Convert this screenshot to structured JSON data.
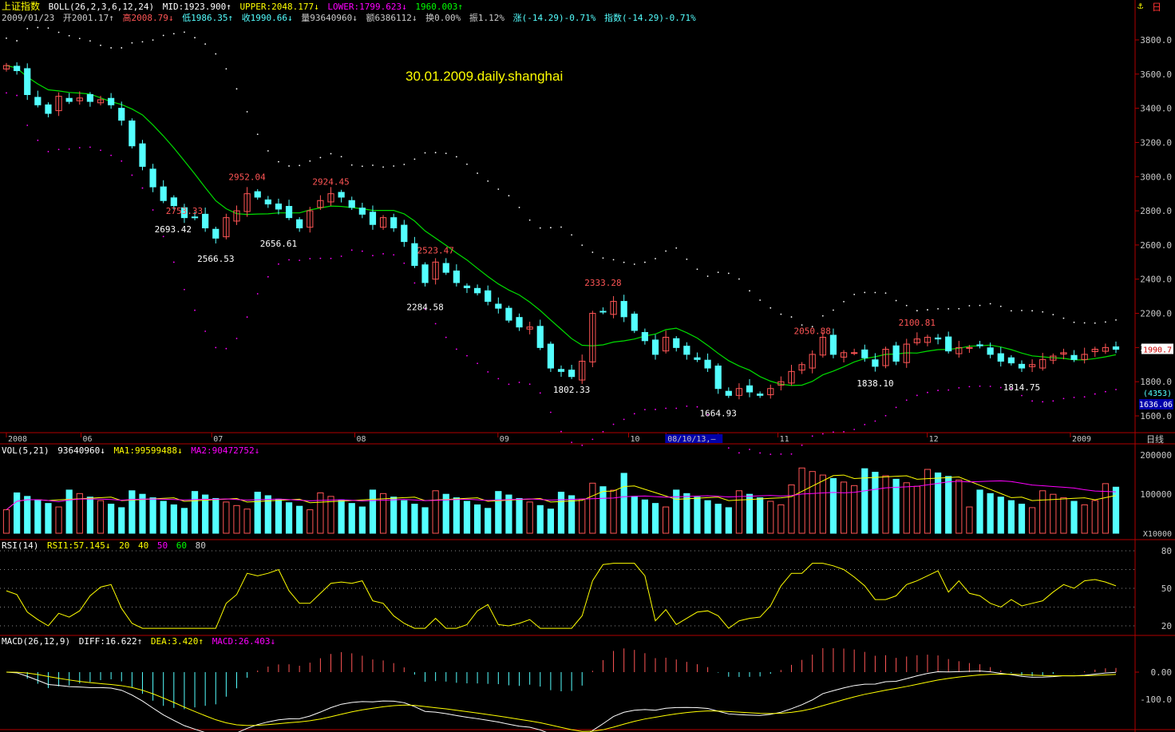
{
  "header": {
    "index_name": "上证指数",
    "indicator": "BOLL(26,2,3,6,12,24)",
    "mid": "MID:1923.900↑",
    "upper": "UPPER:2048.177↓",
    "lower": "LOWER:1799.623↓",
    "extra": "1960.003↑"
  },
  "quote": {
    "date": "2009/01/23",
    "open": "开2001.17↑",
    "high": "高2008.79↓",
    "low": "低1986.35↑",
    "close": "收1990.66↓",
    "volume": "量93640960↓",
    "amount": "额6386112↓",
    "turnover": "换0.00%",
    "amplitude": "振1.12%",
    "change": "涨(-14.29)-0.71%",
    "index_change": "指数(-14.29)-0.71%"
  },
  "annotation_title": "30.01.2009.daily.shanghai",
  "time_axis": {
    "labels": [
      "2008",
      "06",
      "07",
      "08",
      "09",
      "10",
      "08/10/13,—",
      "11",
      "12",
      "2009"
    ],
    "period_label": "日线"
  },
  "price_scale": {
    "ticks": [
      "3800.0",
      "3600.0",
      "3400.0",
      "3200.0",
      "3000.0",
      "2800.0",
      "2600.0",
      "2400.0",
      "2200.0",
      "2000.0",
      "1800.0",
      "1600.0"
    ],
    "current_price_tag": "1990.7",
    "tag_4353": "(4353)",
    "tag_low": "1636.06"
  },
  "volume_panel": {
    "label": "VOL(5,21)",
    "value": "93640960↓",
    "ma1": "MA1:99599488↓",
    "ma2": "MA2:90472752↓",
    "ticks": [
      "200000",
      "100000"
    ],
    "unit": "X10000"
  },
  "rsi_panel": {
    "label": "RSI(14)",
    "rsi1": "RSI1:57.145↓",
    "levels": [
      "20",
      "40",
      "50",
      "60",
      "80"
    ],
    "ticks": [
      "80",
      "50",
      "20"
    ]
  },
  "macd_panel": {
    "label": "MACD(26,12,9)",
    "diff": "DIFF:16.622↑",
    "dea": "DEA:3.420↑",
    "macd": "MACD:26.403↓",
    "ticks": [
      "0.00",
      "-100.0"
    ]
  },
  "price_annotations": [
    {
      "text": "2952.04",
      "i": 23,
      "p": 2952,
      "pos": "above"
    },
    {
      "text": "2924.45",
      "i": 31,
      "p": 2924,
      "pos": "above"
    },
    {
      "text": "2753.33",
      "i": 17,
      "p": 2753,
      "pos": "above"
    },
    {
      "text": "2693.42",
      "i": 18,
      "p": 2693,
      "pos": "left"
    },
    {
      "text": "2566.53",
      "i": 20,
      "p": 2566,
      "pos": "below"
    },
    {
      "text": "2656.61",
      "i": 26,
      "p": 2656,
      "pos": "below"
    },
    {
      "text": "2523.47",
      "i": 41,
      "p": 2523,
      "pos": "above"
    },
    {
      "text": "2284.58",
      "i": 40,
      "p": 2284,
      "pos": "below"
    },
    {
      "text": "2333.28",
      "i": 57,
      "p": 2333,
      "pos": "above"
    },
    {
      "text": "1802.33",
      "i": 54,
      "p": 1802,
      "pos": "below"
    },
    {
      "text": "2050.88",
      "i": 77,
      "p": 2050,
      "pos": "above"
    },
    {
      "text": "1664.93",
      "i": 68,
      "p": 1664,
      "pos": "below"
    },
    {
      "text": "2100.81",
      "i": 87,
      "p": 2100,
      "pos": "above"
    },
    {
      "text": "1838.10",
      "i": 83,
      "p": 1838,
      "pos": "below"
    },
    {
      "text": "1814.75",
      "i": 97,
      "p": 1814,
      "pos": "below"
    }
  ],
  "colors": {
    "up": "#ff5555",
    "down": "#54ffff",
    "axis": "#b00000",
    "mid_line": "#00dd00",
    "upper_band": "#ffffff",
    "lower_band": "#ff00ff",
    "ma1": "#ffff00",
    "ma2": "#ff00ff"
  },
  "chart_data": {
    "type": "candlestick",
    "title": "30.01.2009.daily.shanghai",
    "ylim": [
      1600,
      3850
    ],
    "close": [
      3650,
      3620,
      3480,
      3420,
      3370,
      3470,
      3440,
      3460,
      3440,
      3450,
      3420,
      3330,
      3180,
      3060,
      2940,
      2860,
      2830,
      2760,
      2760,
      2700,
      2640,
      2760,
      2800,
      2900,
      2880,
      2840,
      2810,
      2760,
      2700,
      2800,
      2860,
      2900,
      2880,
      2820,
      2780,
      2720,
      2760,
      2700,
      2620,
      2480,
      2380,
      2500,
      2440,
      2380,
      2350,
      2320,
      2270,
      2230,
      2160,
      2120,
      2120,
      2000,
      1880,
      1860,
      1830,
      1920,
      2200,
      2210,
      2270,
      2180,
      2100,
      2040,
      1960,
      2060,
      2000,
      1960,
      1930,
      1880,
      1760,
      1720,
      1760,
      1740,
      1720,
      1760,
      1800,
      1860,
      1900,
      1960,
      2060,
      1960,
      1970,
      1970,
      1940,
      1890,
      1990,
      1920,
      2020,
      2050,
      2060,
      2050,
      1980,
      2000,
      2000,
      2010,
      1960,
      1920,
      1910,
      1880,
      1900,
      1930,
      1950,
      1970,
      1930,
      1960,
      1990,
      2000,
      1990
    ]
  }
}
